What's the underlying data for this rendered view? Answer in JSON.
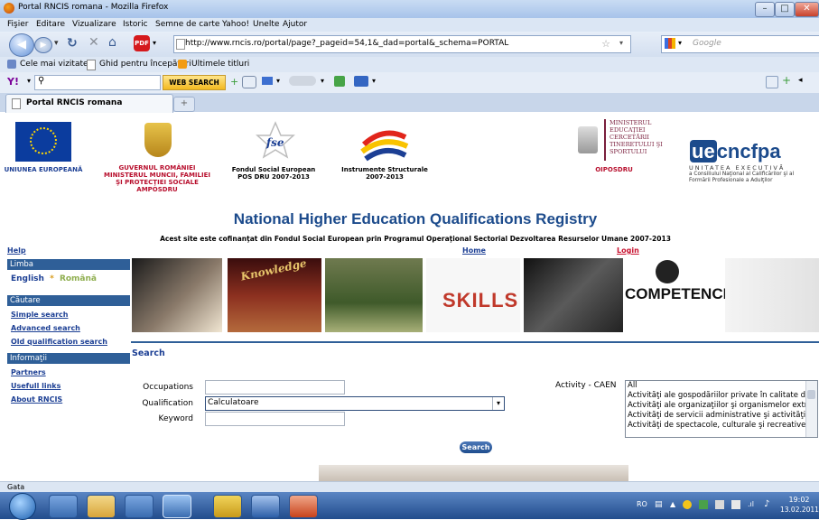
{
  "window": {
    "title": "Portal RNCIS romana - Mozilla Firefox"
  },
  "menu": [
    "Fişier",
    "Editare",
    "Vizualizare",
    "Istoric",
    "Semne de carte",
    "Yahoo!",
    "Unelte",
    "Ajutor"
  ],
  "nav": {
    "url": "http://www.rncis.ro/portal/page?_pageid=54,1&_dad=portal&_schema=PORTAL",
    "search_placeholder": "Google"
  },
  "bookmarks": [
    "Cele mai vizitate",
    "Ghid pentru începători",
    "Ultimele titluri"
  ],
  "toolbar": {
    "web_search": "WEB SEARCH"
  },
  "tab": {
    "label": "Portal RNCIS romana"
  },
  "logos": {
    "eu": "UNIUNEA EUROPEANĂ",
    "gov": "GUVERNUL ROMÂNIEI MINISTERUL MUNCII, FAMILIEI ŞI PROTECŢIEI SOCIALE AMPOSDRU",
    "fse_a": "Fondul Social European",
    "fse_b": "POS DRU 2007-2013",
    "struct_a": "Instrumente Structurale",
    "struct_b": "2007-2013",
    "ministry": "MINISTERUL EDUCAŢIEI CERCETĂRII TINERETULUI ŞI SPORTULUI",
    "oiposdru": "OIPOSDRU",
    "cncfpa_brand": "cncfpa",
    "cncfpa_ue": "ue",
    "cncfpa_sub1": "UNITATEA EXECUTIVĂ",
    "cncfpa_sub2": "a Consiliului Naţional al Calificărilor şi al Formării Profesionale a Adulţilor"
  },
  "page": {
    "title": "National Higher Education Qualifications Registry",
    "cofinance": "Acest site este cofinanţat din Fondul Social European prin Programul Operaţional Sectorial Dezvoltarea Resurselor Umane 2007-2013",
    "help": "Help",
    "home": "Home",
    "login": "Login"
  },
  "sidebar": {
    "limba": "Limba",
    "english": "English",
    "sep": "*",
    "romana": "Română",
    "cautare": "Căutare",
    "simple": "Simple search",
    "advanced": "Advanced search",
    "old": "Old qualification search",
    "informatii": "Informaţii",
    "partners": "Partners",
    "useful": "Usefull links",
    "about": "About RNCIS"
  },
  "banner": {
    "word1": "Knowledge",
    "word2": "SKILLS",
    "word3": "COMPETENCE"
  },
  "search": {
    "heading": "Search",
    "occupations_label": "Occupations",
    "qualification_label": "Qualification",
    "qualification_value": "Calculatoare",
    "keyword_label": "Keyword",
    "activity_label": "Activity - CAEN",
    "caen_options": [
      "All",
      "Activităţi ale gospodăriilor private în calitate de a",
      "Activităţi ale organizaţiilor şi organismelor extrate",
      "Activităţi de servicii administrative şi activităţi de",
      "Activităţi de spectacole, culturale şi recreative"
    ],
    "button": "Search"
  },
  "status": {
    "text": "Gata"
  },
  "taskbar": {
    "lang": "RO",
    "time": "19:02",
    "date": "13.02.2011"
  }
}
